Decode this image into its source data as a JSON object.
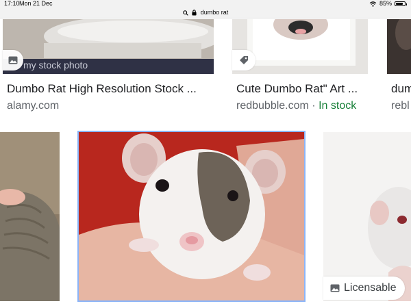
{
  "status_bar": {
    "time": "17:10",
    "date": "Mon 21 Dec",
    "url": "dumbo rat",
    "battery": "85%",
    "battery_level": 0.85,
    "icons": [
      "lock-icon",
      "wifi-icon",
      "battery-icon",
      "search-icon"
    ]
  },
  "results_row1": [
    {
      "title": "Dumbo Rat High Resolution Stock ...",
      "source": "alamy.com",
      "badge": "my stock photo",
      "badge_icon": "image-icon"
    },
    {
      "title": "Cute Dumbo Rat\" Art ...",
      "source": "redbubble.com",
      "separator": "·",
      "availability": "In stock",
      "badge_icon": "tag-icon"
    },
    {
      "title": "dum",
      "source": "rebl"
    }
  ],
  "results_row2": [
    {
      "label": ""
    },
    {
      "label": "",
      "selected": true
    },
    {
      "label": "Licensable",
      "badge_icon": "image-icon"
    }
  ],
  "colors": {
    "title": "#202124",
    "source": "#5f6368",
    "in_stock": "#188038",
    "selected_border": "#8ab4f8"
  }
}
